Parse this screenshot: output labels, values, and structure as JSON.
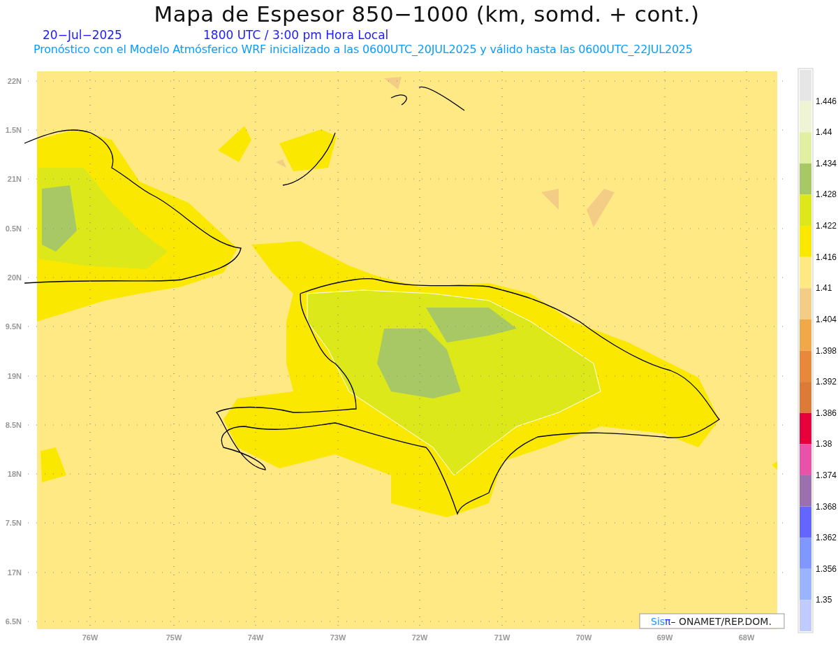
{
  "title": "Mapa de Espesor 850−1000 (km, somd. + cont.)",
  "date": "20−Jul−2025",
  "time": "1800 UTC / 3:00 pm Hora Local",
  "description": "Pronóstico con el Modelo Atmósferico WRF inicializado a las 0600UTC_20JUL2025 y válido hasta las  0600UTC_22JUL2025",
  "y_axis_labels": [
    "22N",
    "1.5N",
    "21N",
    "0.5N",
    "20N",
    "9.5N",
    "19N",
    "8.5N",
    "18N",
    "7.5N",
    "17N",
    "6.5N"
  ],
  "x_axis_labels": [
    "76W",
    "75W",
    "74W",
    "73W",
    "72W",
    "71W",
    "70W",
    "69W",
    "68W"
  ],
  "colorbar": {
    "segments": [
      {
        "color": "#e6e6e6"
      },
      {
        "color": "#eef4d4"
      },
      {
        "color": "#e0f0a0"
      },
      {
        "color": "#a8c865"
      },
      {
        "color": "#dde81a"
      },
      {
        "color": "#fbe800"
      },
      {
        "color": "#ffe985"
      },
      {
        "color": "#f3cc85"
      },
      {
        "color": "#f0a848"
      },
      {
        "color": "#e8883a"
      },
      {
        "color": "#dc7a38"
      },
      {
        "color": "#e8003c"
      },
      {
        "color": "#e852a8"
      },
      {
        "color": "#9c6fae"
      },
      {
        "color": "#6566ff"
      },
      {
        "color": "#8097ff"
      },
      {
        "color": "#9ab4ff"
      },
      {
        "color": "#c0ccff"
      }
    ],
    "labels": [
      "1.446",
      "1.44",
      "1.434",
      "1.428",
      "1.422",
      "1.416",
      "1.41",
      "1.404",
      "1.398",
      "1.392",
      "1.386",
      "1.38",
      "1.374",
      "1.368",
      "1.362",
      "1.356",
      "1.35"
    ]
  },
  "credit": {
    "brand": "Sis",
    "symbol": "π",
    "text": "– ONAMET/REP.DOM."
  }
}
